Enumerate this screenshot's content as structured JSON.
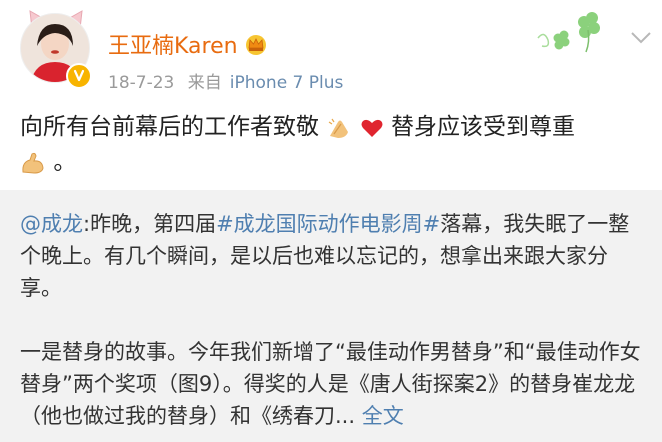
{
  "post": {
    "username": "王亚楠Karen",
    "date": "18-7-23",
    "source_prefix": "来自",
    "source_device": "iPhone 7 Plus",
    "text_part1": "向所有台前幕后的工作者致敬",
    "text_part2": "替身应该受到尊重",
    "text_part3": "。",
    "emoji_1": "clap-hands-icon",
    "emoji_2": "red-heart-icon",
    "emoji_3": "flexed-biceps-icon"
  },
  "repost": {
    "mention": "@成龙",
    "part1": ":昨晚，第四届",
    "hashtag": "#成龙国际动作电影周#",
    "part2": "落幕，我失眠了一整个晚上。有几个瞬间，是以后也难以忘记的，想拿出来跟大家分享。",
    "paragraph2": "一是替身的故事。今年我们新增了“最佳动作男替身”和“最佳动作女替身”两个奖项（图9）。得奖的人是《唐人街探案2》的替身崔龙龙（他也做过我的替身）和《绣春刀...",
    "full_text_link": "全文"
  },
  "colors": {
    "username": "#e86b0f",
    "link": "#4f7fb0",
    "meta": "#9a9a9a",
    "repost_bg": "#f2f2f2",
    "verified": "#f8b400"
  }
}
